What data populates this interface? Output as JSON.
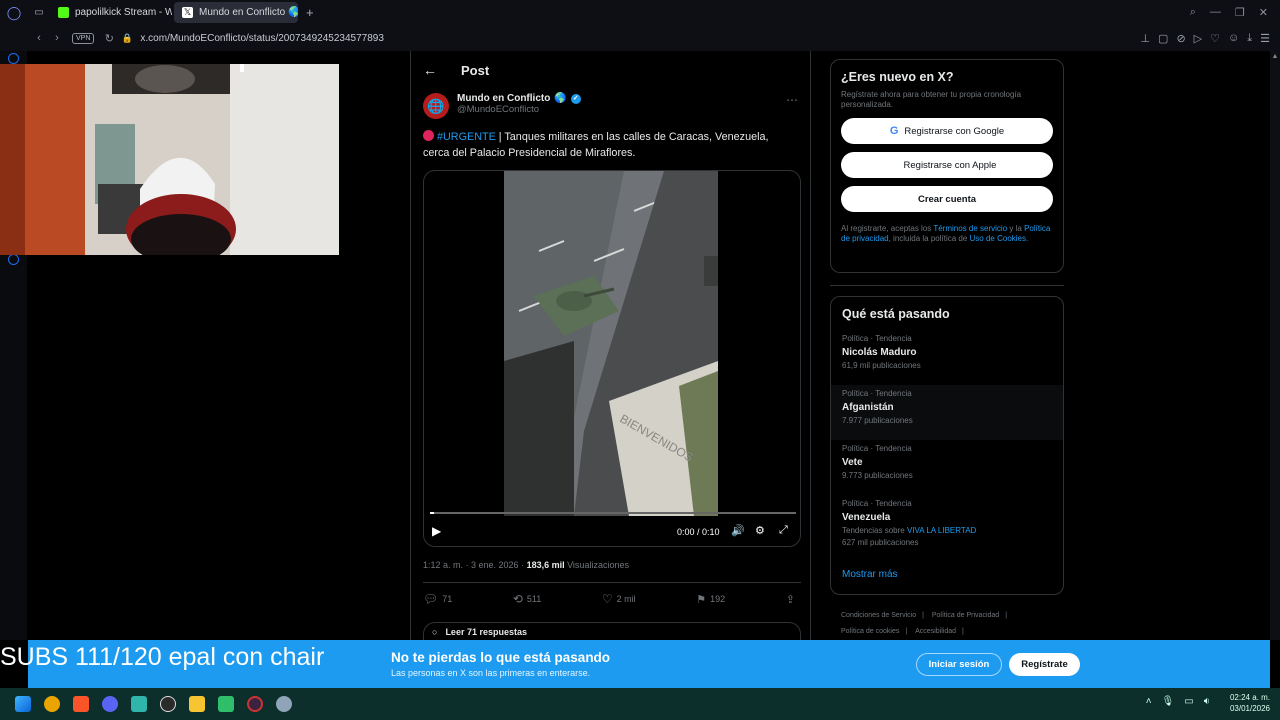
{
  "browser": {
    "tabs": [
      {
        "label": "papolilkick Stream - Watc",
        "active": false
      },
      {
        "label": "Mundo en Conflicto 🌎 en",
        "active": true
      }
    ],
    "url": "x.com/MundoEConflicto/status/2007349245234577893",
    "vpn_label": "VPN"
  },
  "post": {
    "header_title": "Post",
    "author_name": "Mundo en Conflicto",
    "author_handle": "@MundoEConflicto",
    "hashtag": "#URGENTE",
    "text_line1": " | Tanques militares en las calles de Caracas, Venezuela,",
    "text_line2": "cerca del Palacio Presidencial de Miraflores.",
    "video_time": "0:00 / 0:10",
    "video_progress": 0.0,
    "timestamp": "1:12 a. m. · 3 ene. 2026 · ",
    "views_count": "183,6 mil",
    "views_label": " Visualizaciones",
    "replies": "71",
    "reposts": "511",
    "likes": "2 mil",
    "bookmarks": "192",
    "read_replies": "Leer 71 respuestas"
  },
  "signup": {
    "title": "¿Eres nuevo en X?",
    "subtitle": "Regístrate ahora para obtener tu propia cronología personalizada.",
    "google": "Registrarse con Google",
    "apple": "Registrarse con Apple",
    "create": "Crear cuenta",
    "legal_a": "Al registrarte, aceptas los ",
    "legal_terms": "Términos de servicio",
    "legal_b": " y la ",
    "legal_privacy": "Política de privacidad",
    "legal_c": ", incluida la política de ",
    "legal_cookies": "Uso de Cookies",
    "legal_d": "."
  },
  "trends": {
    "title": "Qué está pasando",
    "items": [
      {
        "category": "Política · Tendencia",
        "name": "Nicolás Maduro",
        "count": "61,9 mil publicaciones"
      },
      {
        "category": "Política · Tendencia",
        "name": "Afganistán",
        "count": "7.977 publicaciones"
      },
      {
        "category": "Política · Tendencia",
        "name": "Vete",
        "count": "9.773 publicaciones"
      },
      {
        "category": "Política · Tendencia",
        "name": "Venezuela",
        "extra_prefix": "Tendencias sobre ",
        "extra_link": "VIVA LA LIBERTAD",
        "count": "627 mil publicaciones"
      }
    ],
    "show_more": "Mostrar más"
  },
  "footer_links": [
    "Condiciones de Servicio",
    "Política de Privacidad",
    "Política de cookies",
    "Accesibilidad"
  ],
  "overlay_text": "SUBS 111/120 epal con chair",
  "banner": {
    "title": "No te pierdas lo que está pasando",
    "subtitle": "Las personas en X son las primeras en enterarse.",
    "login": "Iniciar sesión",
    "register": "Regístrate"
  },
  "taskbar": {
    "time": "02:24 a. m.",
    "date": "03/01/2026"
  },
  "colors": {
    "accent": "#1d9bf0",
    "banner": "#1d9bf0",
    "taskbar": "#0c2f2b"
  }
}
